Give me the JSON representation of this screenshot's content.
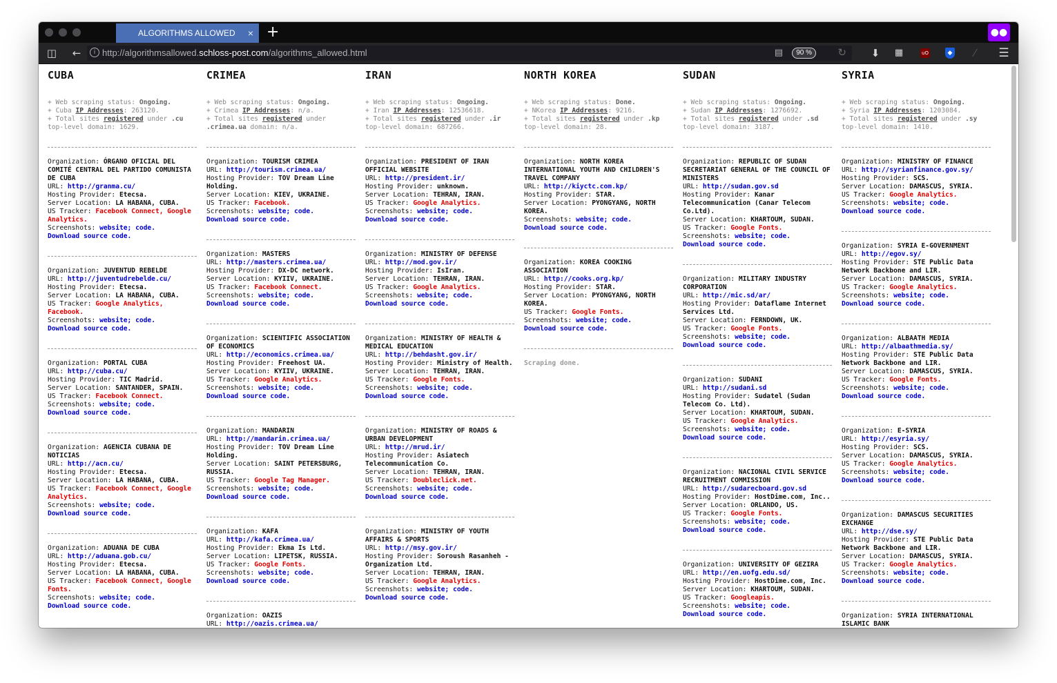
{
  "window": {
    "tab_title": "ALGORITHMS ALLOWED",
    "tab_close": "×",
    "new_tab": "+",
    "url_prefix": "http://algorithmsallowed.",
    "url_domain": "schloss-post.com",
    "url_path": "/algorithms_allowed.html",
    "zoom": "90 %"
  },
  "icons": {
    "sidebar": "sidebar-icon",
    "back": "back-arrow-icon",
    "info": "info-icon",
    "reader": "reader-view-icon",
    "reload": "reload-icon",
    "download": "download-arrow-icon",
    "qr": "qr-code-icon",
    "ublock": "ublock-icon",
    "bitwarden": "bitwarden-shield-icon",
    "menu": "hamburger-menu-icon",
    "mask": "private-mask-icon"
  },
  "labels": {
    "status_prefix": "+ Web scraping status: ",
    "ip_label": "IP Addresses",
    "total_prefix": "+ Total sites ",
    "registered": "registered",
    "under": " under ",
    "org": "Organization: ",
    "url": "URL: ",
    "host": "Hosting Provider: ",
    "loc": "Server Location: ",
    "tracker": "US Tracker: ",
    "shots": "Screenshots: ",
    "website": "website;",
    "code": "code.",
    "download": "Download source code."
  },
  "columns": [
    {
      "title": "CUBA",
      "status": "Ongoing.",
      "country_short": "Cuba",
      "ip_count": "263120.",
      "tld": ".cu",
      "tld_count": "1629.",
      "entries": [
        {
          "org": "ÓRGANO OFICIAL DEL COMITÉ CENTRAL DEL PARTIDO COMUNISTA DE CUBA",
          "url": "http://granma.cu/",
          "host": "Etecsa.",
          "loc": "LA HABANA, CUBA.",
          "tracker": "Facebook Connect, Google Analytics."
        },
        {
          "org": "JUVENTUD REBELDE",
          "url": "http://juventudrebelde.cu/",
          "host": "Etecsa.",
          "loc": "LA HABANA, CUBA.",
          "tracker": "Google Analytics, Facebook."
        },
        {
          "org": "PORTAL CUBA",
          "url": "http://cuba.cu/",
          "host": "TIC Madrid.",
          "loc": "SANTANDER, SPAIN.",
          "tracker": "Facebook Connect."
        },
        {
          "org": "AGENCIA CUBANA DE NOTICIAS",
          "url": "http://acn.cu/",
          "host": "Etecsa.",
          "loc": "LA HABANA, CUBA.",
          "tracker": "Facebook Connect, Google Analytics."
        },
        {
          "org": "ADUANA DE CUBA",
          "url": "http://aduana.gob.cu/",
          "host": "Etecsa.",
          "loc": "LA HABANA, CUBA.",
          "tracker": "Facebook Connect, Google Fonts."
        }
      ]
    },
    {
      "title": "CRIMEA",
      "status": "Ongoing.",
      "country_short": "Crimea",
      "ip_count": "n/a.",
      "tld": "under .crimea.ua",
      "tld_count": "n/a.",
      "entries": [
        {
          "org": "TOURISM CRIMEA",
          "url": "http://tourism.crimea.ua/",
          "host": "TOV Dream Line Holding.",
          "loc": "KIEV, UKRAINE.",
          "tracker": "Facebook."
        },
        {
          "org": "MASTERS",
          "url": "http://masters.crimea.ua/",
          "host": "DX-DC network.",
          "loc": "KYIIV, UKRAINE.",
          "tracker": "Facebook Connect."
        },
        {
          "org": "SCIENTIFIC ASSOCIATION OF ECONOMICS",
          "url": "http://economics.crimea.ua/",
          "host": "Freehost UA.",
          "loc": "KYIIV, UKRAINE.",
          "tracker": "Google Analytics."
        },
        {
          "org": "MANDARIN",
          "url": "http://mandarin.crimea.ua/",
          "host": "TOV Dream Line Holding.",
          "loc": "SAINT PETERSBURG, RUSSIA.",
          "tracker": "Google Tag Manager."
        },
        {
          "org": "KAFA",
          "url": "http://kafa.crimea.ua/",
          "host": "Ekma Is Ltd.",
          "loc": "LIPETSK, RUSSIA.",
          "tracker": "Google Fonts."
        },
        {
          "org": "OAZIS",
          "url": "http://oazis.crimea.ua/",
          "host": "",
          "loc": "",
          "tracker": ""
        }
      ]
    },
    {
      "title": "IRAN",
      "status": "Ongoing.",
      "country_short": "Iran",
      "ip_count": "12536618.",
      "tld": ".ir",
      "tld_count": "687266.",
      "entries": [
        {
          "org": "PRESIDENT OF IRAN OFFICIAL WEBSITE",
          "url": "http://president.ir/",
          "host": "unknown.",
          "loc": "TEHRAN, IRAN.",
          "tracker": "Google Analytics."
        },
        {
          "org": "MINISTRY OF DEFENSE",
          "url": "http://mod.gov.ir/",
          "host": "IsIran.",
          "loc": "TEHRAN, IRAN.",
          "tracker": "Google Analytics."
        },
        {
          "org": "MINISTRY OF HEALTH & MEDICAL EDUCATION",
          "url": "http://behdasht.gov.ir/",
          "host": "Ministry of Health.",
          "loc": "TEHRAN, IRAN.",
          "tracker": "Google Fonts."
        },
        {
          "org": "MINISTRY OF ROADS & URBAN DEVELOPMENT",
          "url": "http://mrud.ir/",
          "host": "Asiatech Telecommunication Co.",
          "loc": "TEHRAN, IRAN.",
          "tracker": "Doubleclick.net."
        },
        {
          "org": "MINISTRY OF YOUTH AFFAIRS & SPORTS",
          "url": "http://msy.gov.ir/",
          "host": "Soroush Rasanheh - Organization Ltd.",
          "loc": "TEHRAN, IRAN.",
          "tracker": "Google Analytics."
        }
      ]
    },
    {
      "title": "NORTH KOREA",
      "status": "Done.",
      "country_short": "NKorea",
      "ip_count": "9216.",
      "tld": ".kp",
      "tld_count": "28.",
      "done_text": "Scraping done.",
      "entries": [
        {
          "org": "NORTH KOREA INTERNATIONAL YOUTH AND CHILDREN'S TRAVEL COMPANY",
          "url": "http://kiyctc.com.kp/",
          "host": "STAR.",
          "loc": "PYONGYANG, NORTH KOREA.",
          "tracker": ""
        },
        {
          "org": "KOREA COOKING ASSOCIATION",
          "url": "http://cooks.org.kp/",
          "host": "STAR.",
          "loc": "PYONGYANG, NORTH KOREA.",
          "tracker": "Google Fonts."
        }
      ]
    },
    {
      "title": "SUDAN",
      "status": "Ongoing.",
      "country_short": "Sudan",
      "ip_count": "1276692.",
      "tld": ".sd",
      "tld_count": "3187.",
      "entries": [
        {
          "org": "REPUBLIC OF SUDAN SECRETARIAT GENERAL OF THE COUNCIL OF MINISTERS",
          "url": "http://sudan.gov.sd",
          "host": "Kanar Telecommunication (Canar Telecom Co.Ltd).",
          "loc": "KHARTOUM, SUDAN.",
          "tracker": "Google Fonts."
        },
        {
          "org": "MILITARY INDUSTRY CORPORATION",
          "url": "http://mic.sd/ar/",
          "host": "Dataflame Internet Services Ltd.",
          "loc": "FERNDOWN, UK.",
          "tracker": "Google Fonts."
        },
        {
          "org": "SUDANI",
          "url": "http://sudani.sd",
          "host": "Sudatel (Sudan Telecom Co. Ltd).",
          "loc": "KHARTOUM, SUDAN.",
          "tracker": "Google Analytics."
        },
        {
          "org": "NACIONAL CIVIL SERVICE RECRUITMENT COMMISSION",
          "url": "http://sudarecboard.gov.sd",
          "host": "HostDime.com, Inc..",
          "loc": "ORLANDO, US.",
          "tracker": "Google Fonts."
        },
        {
          "org": "UNIVERSITY OF GEZIRA",
          "url": "http://en.uofg.edu.sd/",
          "host": "HostDime.com, Inc.",
          "loc": "KHARTOUM, SUDAN.",
          "tracker": "Googleapis."
        }
      ]
    },
    {
      "title": "SYRIA",
      "status": "Ongoing.",
      "country_short": "Syria",
      "ip_count": "1203084.",
      "tld": ".sy",
      "tld_count": "1410.",
      "entries": [
        {
          "org": "MINISTRY OF FINANCE",
          "url": "http://syrianfinance.gov.sy/",
          "host": "SCS.",
          "loc": "DAMASCUS, SYRIA.",
          "tracker": "Google Analytics."
        },
        {
          "org": "SYRIA E-GOVERNMENT",
          "url": "http://egov.sy/",
          "host": "STE Public Data Network Backbone and LIR.",
          "loc": "DAMASCUS, SYRIA.",
          "tracker": "Google Analytics."
        },
        {
          "org": "ALBAATH MEDIA",
          "url": "http://albaathmedia.sy/",
          "host": "STE Public Data Network Backbone and LIR.",
          "loc": "DAMASCUS, SYRIA.",
          "tracker": "Google Fonts."
        },
        {
          "org": "E-SYRIA",
          "url": "http://esyria.sy/",
          "host": "SCS.",
          "loc": "DAMASCUS, SYRIA.",
          "tracker": "Google Analytics."
        },
        {
          "org": "DAMASCUS SECURITIES EXCHANGE",
          "url": "http://dse.sy/",
          "host": "STE Public Data Network Backbone and LIR.",
          "loc": "DAMASCUS, SYRIA.",
          "tracker": "Google Analytics."
        },
        {
          "org": "SYRIA INTERNATIONAL ISLAMIC BANK",
          "url": "",
          "host": "",
          "loc": "",
          "tracker": ""
        }
      ]
    }
  ]
}
